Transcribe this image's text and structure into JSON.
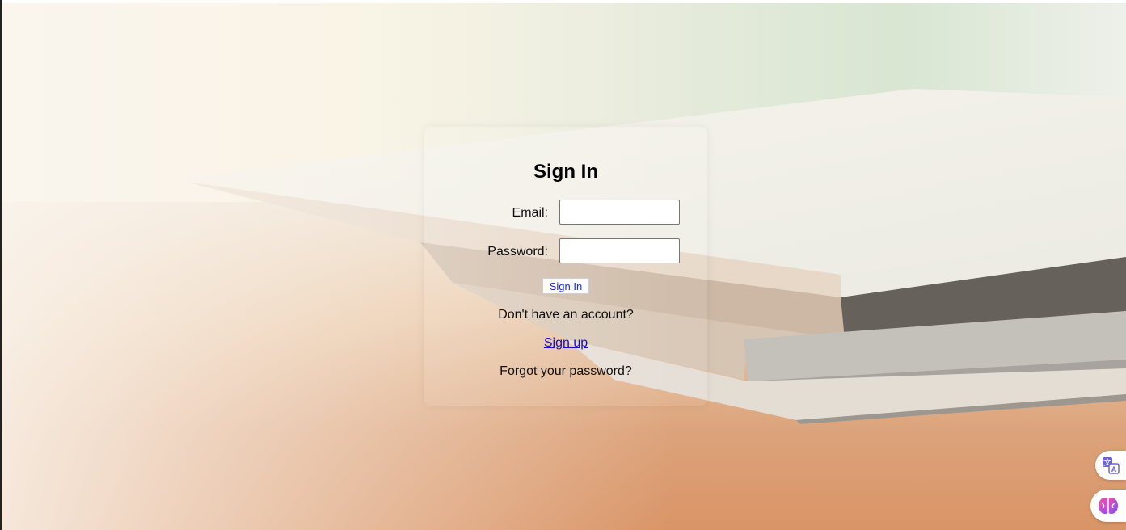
{
  "signin": {
    "title": "Sign In",
    "email_label": "Email:",
    "password_label": "Password:",
    "email_value": "",
    "password_value": "",
    "submit_label": "Sign In",
    "no_account_text": "Don't have an account?",
    "signup_link": "Sign up",
    "forgot_text": "Forgot your password?"
  },
  "floating_buttons": [
    {
      "icon": "translate-icon"
    },
    {
      "icon": "brain-icon"
    }
  ],
  "colors": {
    "link": "#1a0dcc",
    "button_text": "#1a2bd6",
    "brain_gradient_start": "#ff4fa3",
    "brain_gradient_end": "#7a4dff"
  }
}
